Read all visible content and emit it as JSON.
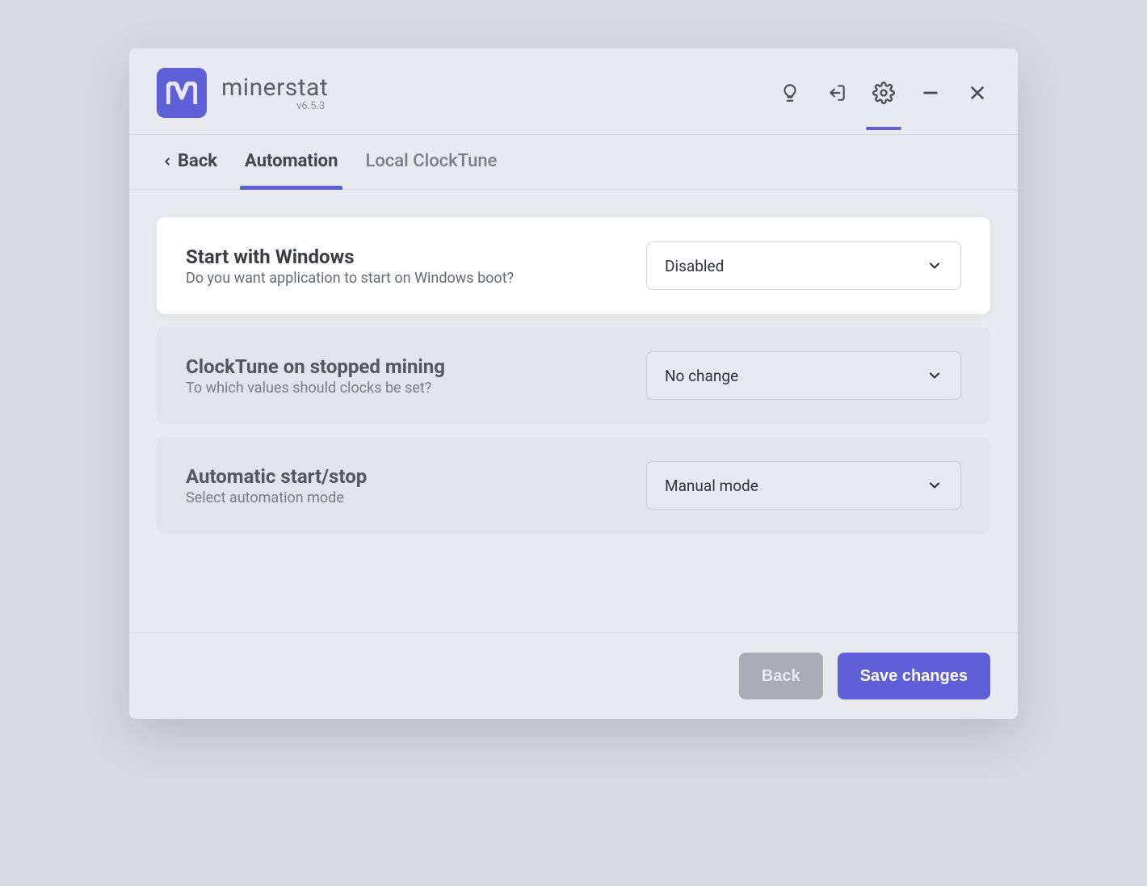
{
  "brand": {
    "name": "minerstat",
    "version": "v6.5.3"
  },
  "tabs": {
    "back": "Back",
    "automation": "Automation",
    "clocktune": "Local ClockTune"
  },
  "settings": [
    {
      "title": "Start with Windows",
      "desc": "Do you want application to start on Windows boot?",
      "value": "Disabled",
      "highlight": true
    },
    {
      "title": "ClockTune on stopped mining",
      "desc": "To which values should clocks be set?",
      "value": "No change",
      "highlight": false
    },
    {
      "title": "Automatic start/stop",
      "desc": "Select automation mode",
      "value": "Manual mode",
      "highlight": false
    }
  ],
  "footer": {
    "back": "Back",
    "save": "Save changes"
  }
}
